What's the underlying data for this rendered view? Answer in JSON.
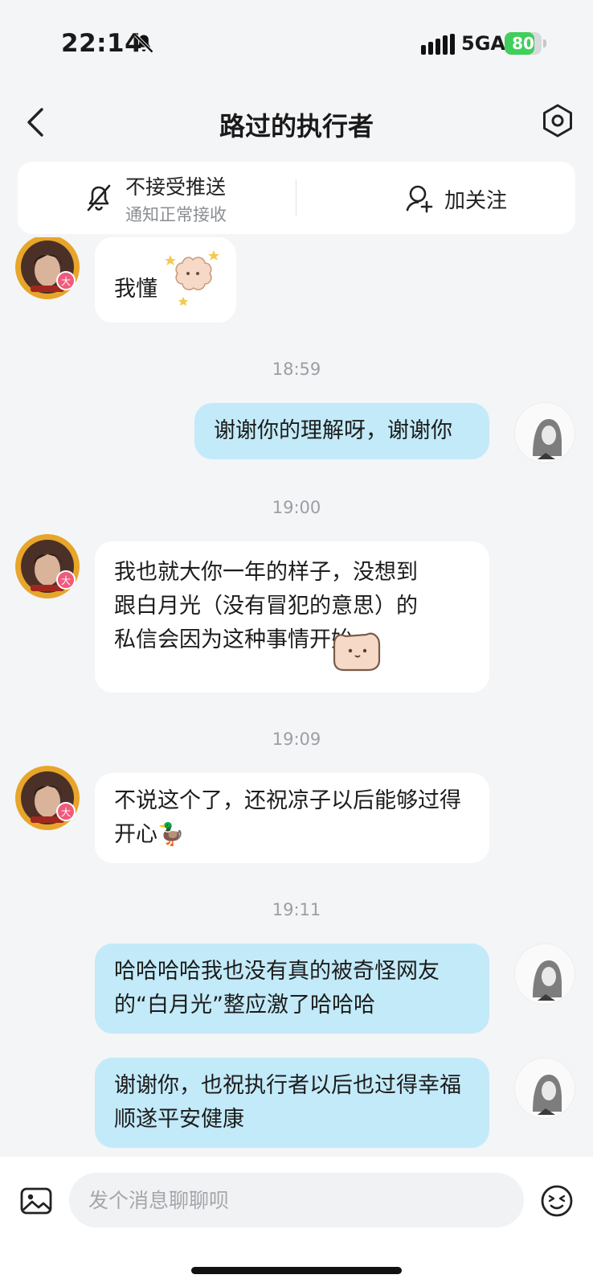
{
  "status_bar": {
    "time": "22:14",
    "network": "5GA",
    "battery": "80",
    "battery_level": 0.8
  },
  "header": {
    "title": "路过的执行者",
    "back_icon": "chevron-left-icon",
    "settings_icon": "settings-icon"
  },
  "actions": {
    "push": {
      "label": "不接受推送",
      "sub": "通知正常接收",
      "icon": "bell-off-icon"
    },
    "follow": {
      "label": "加关注",
      "icon": "add-user-icon"
    }
  },
  "colors": {
    "incoming_bubble": "#ffffff",
    "outgoing_bubble": "#c3eaf8",
    "background": "#f4f5f7"
  },
  "messages": [
    {
      "side": "in",
      "text": "我懂",
      "sticker": "sheep-sticker"
    },
    {
      "type": "time",
      "text": "18:59"
    },
    {
      "side": "out",
      "text": "谢谢你的理解呀，谢谢你"
    },
    {
      "type": "time",
      "text": "19:00"
    },
    {
      "side": "in",
      "text": "我也就大你一年的样子，没想到跟白月光（没有冒犯的意思）的私信会因为这种事情开始",
      "sticker": "cat-sticker"
    },
    {
      "type": "time",
      "text": "19:09"
    },
    {
      "side": "in",
      "text": "不说这个了，还祝凉子以后能够过得开心",
      "emoji": "🦆"
    },
    {
      "type": "time",
      "text": "19:11"
    },
    {
      "side": "out",
      "text": "哈哈哈哈我也没有真的被奇怪网友的“白月光”整应激了哈哈哈"
    },
    {
      "side": "out",
      "text": "谢谢你，也祝执行者以后也过得幸福顺遂平安健康"
    }
  ],
  "composer": {
    "placeholder": "发个消息聊聊呗",
    "image_icon": "image-icon",
    "emoji_icon": "emoji-icon"
  }
}
